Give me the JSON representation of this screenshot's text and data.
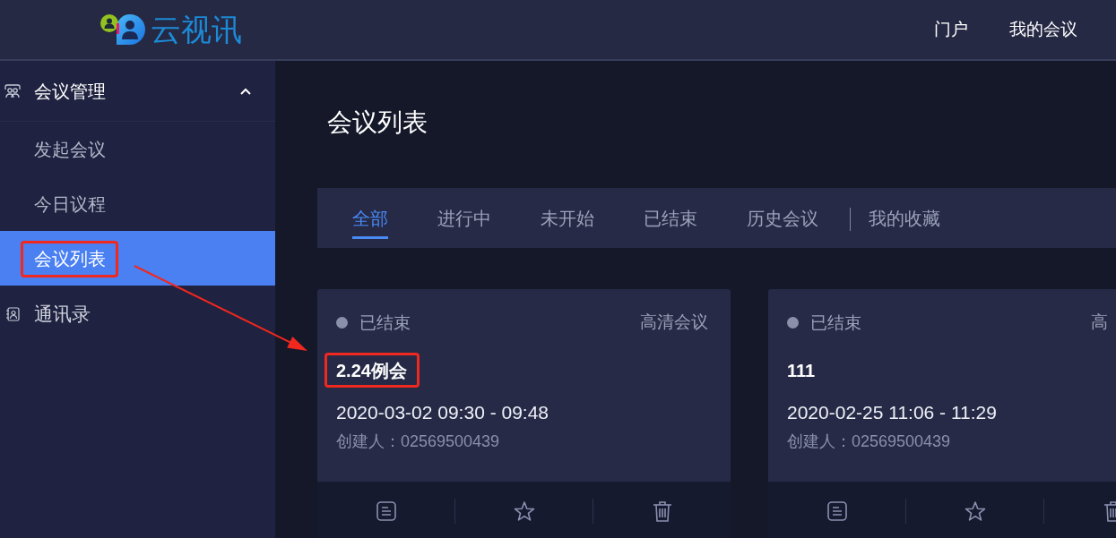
{
  "header": {
    "logo_text": "云视讯",
    "nav": [
      {
        "label": "门户"
      },
      {
        "label": "我的会议"
      }
    ]
  },
  "sidebar": {
    "items": [
      {
        "kind": "group",
        "label": "会议管理",
        "expanded": true,
        "children": [
          {
            "label": "发起会议",
            "selected": false,
            "highlighted": false
          },
          {
            "label": "今日议程",
            "selected": false,
            "highlighted": false
          },
          {
            "label": "会议列表",
            "selected": true,
            "highlighted": true
          }
        ]
      },
      {
        "kind": "link",
        "label": "通讯录"
      }
    ]
  },
  "main": {
    "title": "会议列表",
    "tabs": [
      {
        "kind": "filter",
        "label": "全部",
        "selected": true
      },
      {
        "kind": "filter",
        "label": "进行中",
        "selected": false
      },
      {
        "kind": "filter",
        "label": "未开始",
        "selected": false
      },
      {
        "kind": "filter",
        "label": "已结束",
        "selected": false
      },
      {
        "kind": "filter",
        "label": "历史会议",
        "selected": false
      },
      {
        "kind": "favorites",
        "label": "我的收藏",
        "selected": false
      }
    ],
    "cards": [
      {
        "status": "已结束",
        "type": "高清会议",
        "title": "2.24例会",
        "title_highlighted": true,
        "time": "2020-03-02 09:30 - 09:48",
        "creator": "创建人：02569500439"
      },
      {
        "status": "已结束",
        "type": "高",
        "title": "111",
        "title_highlighted": false,
        "time": "2020-02-25 11:06 - 11:29",
        "creator": "创建人：02569500439"
      }
    ]
  },
  "annotation_arrow": true
}
